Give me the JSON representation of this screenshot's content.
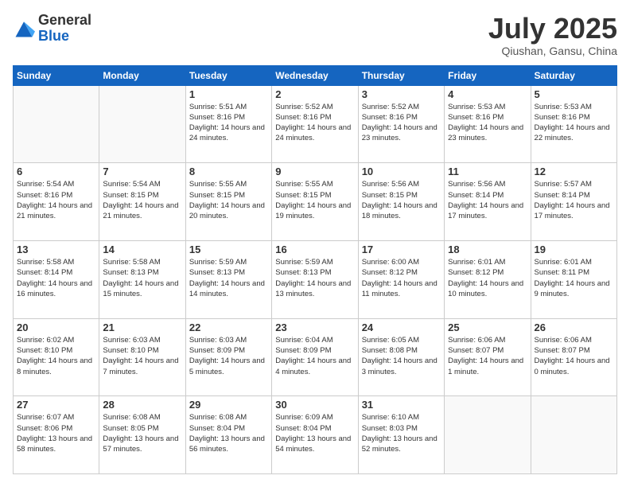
{
  "logo": {
    "general": "General",
    "blue": "Blue"
  },
  "title": "July 2025",
  "location": "Qiushan, Gansu, China",
  "days_of_week": [
    "Sunday",
    "Monday",
    "Tuesday",
    "Wednesday",
    "Thursday",
    "Friday",
    "Saturday"
  ],
  "weeks": [
    [
      null,
      null,
      {
        "day": "1",
        "sunrise": "Sunrise: 5:51 AM",
        "sunset": "Sunset: 8:16 PM",
        "daylight": "Daylight: 14 hours and 24 minutes."
      },
      {
        "day": "2",
        "sunrise": "Sunrise: 5:52 AM",
        "sunset": "Sunset: 8:16 PM",
        "daylight": "Daylight: 14 hours and 24 minutes."
      },
      {
        "day": "3",
        "sunrise": "Sunrise: 5:52 AM",
        "sunset": "Sunset: 8:16 PM",
        "daylight": "Daylight: 14 hours and 23 minutes."
      },
      {
        "day": "4",
        "sunrise": "Sunrise: 5:53 AM",
        "sunset": "Sunset: 8:16 PM",
        "daylight": "Daylight: 14 hours and 23 minutes."
      },
      {
        "day": "5",
        "sunrise": "Sunrise: 5:53 AM",
        "sunset": "Sunset: 8:16 PM",
        "daylight": "Daylight: 14 hours and 22 minutes."
      }
    ],
    [
      {
        "day": "6",
        "sunrise": "Sunrise: 5:54 AM",
        "sunset": "Sunset: 8:16 PM",
        "daylight": "Daylight: 14 hours and 21 minutes."
      },
      {
        "day": "7",
        "sunrise": "Sunrise: 5:54 AM",
        "sunset": "Sunset: 8:15 PM",
        "daylight": "Daylight: 14 hours and 21 minutes."
      },
      {
        "day": "8",
        "sunrise": "Sunrise: 5:55 AM",
        "sunset": "Sunset: 8:15 PM",
        "daylight": "Daylight: 14 hours and 20 minutes."
      },
      {
        "day": "9",
        "sunrise": "Sunrise: 5:55 AM",
        "sunset": "Sunset: 8:15 PM",
        "daylight": "Daylight: 14 hours and 19 minutes."
      },
      {
        "day": "10",
        "sunrise": "Sunrise: 5:56 AM",
        "sunset": "Sunset: 8:15 PM",
        "daylight": "Daylight: 14 hours and 18 minutes."
      },
      {
        "day": "11",
        "sunrise": "Sunrise: 5:56 AM",
        "sunset": "Sunset: 8:14 PM",
        "daylight": "Daylight: 14 hours and 17 minutes."
      },
      {
        "day": "12",
        "sunrise": "Sunrise: 5:57 AM",
        "sunset": "Sunset: 8:14 PM",
        "daylight": "Daylight: 14 hours and 17 minutes."
      }
    ],
    [
      {
        "day": "13",
        "sunrise": "Sunrise: 5:58 AM",
        "sunset": "Sunset: 8:14 PM",
        "daylight": "Daylight: 14 hours and 16 minutes."
      },
      {
        "day": "14",
        "sunrise": "Sunrise: 5:58 AM",
        "sunset": "Sunset: 8:13 PM",
        "daylight": "Daylight: 14 hours and 15 minutes."
      },
      {
        "day": "15",
        "sunrise": "Sunrise: 5:59 AM",
        "sunset": "Sunset: 8:13 PM",
        "daylight": "Daylight: 14 hours and 14 minutes."
      },
      {
        "day": "16",
        "sunrise": "Sunrise: 5:59 AM",
        "sunset": "Sunset: 8:13 PM",
        "daylight": "Daylight: 14 hours and 13 minutes."
      },
      {
        "day": "17",
        "sunrise": "Sunrise: 6:00 AM",
        "sunset": "Sunset: 8:12 PM",
        "daylight": "Daylight: 14 hours and 11 minutes."
      },
      {
        "day": "18",
        "sunrise": "Sunrise: 6:01 AM",
        "sunset": "Sunset: 8:12 PM",
        "daylight": "Daylight: 14 hours and 10 minutes."
      },
      {
        "day": "19",
        "sunrise": "Sunrise: 6:01 AM",
        "sunset": "Sunset: 8:11 PM",
        "daylight": "Daylight: 14 hours and 9 minutes."
      }
    ],
    [
      {
        "day": "20",
        "sunrise": "Sunrise: 6:02 AM",
        "sunset": "Sunset: 8:10 PM",
        "daylight": "Daylight: 14 hours and 8 minutes."
      },
      {
        "day": "21",
        "sunrise": "Sunrise: 6:03 AM",
        "sunset": "Sunset: 8:10 PM",
        "daylight": "Daylight: 14 hours and 7 minutes."
      },
      {
        "day": "22",
        "sunrise": "Sunrise: 6:03 AM",
        "sunset": "Sunset: 8:09 PM",
        "daylight": "Daylight: 14 hours and 5 minutes."
      },
      {
        "day": "23",
        "sunrise": "Sunrise: 6:04 AM",
        "sunset": "Sunset: 8:09 PM",
        "daylight": "Daylight: 14 hours and 4 minutes."
      },
      {
        "day": "24",
        "sunrise": "Sunrise: 6:05 AM",
        "sunset": "Sunset: 8:08 PM",
        "daylight": "Daylight: 14 hours and 3 minutes."
      },
      {
        "day": "25",
        "sunrise": "Sunrise: 6:06 AM",
        "sunset": "Sunset: 8:07 PM",
        "daylight": "Daylight: 14 hours and 1 minute."
      },
      {
        "day": "26",
        "sunrise": "Sunrise: 6:06 AM",
        "sunset": "Sunset: 8:07 PM",
        "daylight": "Daylight: 14 hours and 0 minutes."
      }
    ],
    [
      {
        "day": "27",
        "sunrise": "Sunrise: 6:07 AM",
        "sunset": "Sunset: 8:06 PM",
        "daylight": "Daylight: 13 hours and 58 minutes."
      },
      {
        "day": "28",
        "sunrise": "Sunrise: 6:08 AM",
        "sunset": "Sunset: 8:05 PM",
        "daylight": "Daylight: 13 hours and 57 minutes."
      },
      {
        "day": "29",
        "sunrise": "Sunrise: 6:08 AM",
        "sunset": "Sunset: 8:04 PM",
        "daylight": "Daylight: 13 hours and 56 minutes."
      },
      {
        "day": "30",
        "sunrise": "Sunrise: 6:09 AM",
        "sunset": "Sunset: 8:04 PM",
        "daylight": "Daylight: 13 hours and 54 minutes."
      },
      {
        "day": "31",
        "sunrise": "Sunrise: 6:10 AM",
        "sunset": "Sunset: 8:03 PM",
        "daylight": "Daylight: 13 hours and 52 minutes."
      },
      null,
      null
    ]
  ]
}
